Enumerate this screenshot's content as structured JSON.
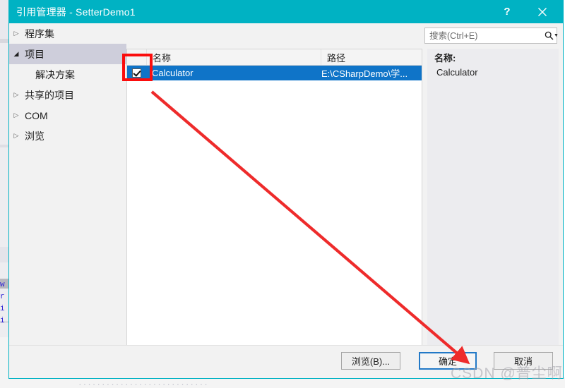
{
  "window": {
    "title": "引用管理器 - SetterDemo1",
    "help_label": "?",
    "close_label": "×",
    "accent_color": "#00b2c3"
  },
  "search": {
    "placeholder": "搜索(Ctrl+E)",
    "value": "",
    "icon": "search-icon",
    "dropdown_icon": "chevron-down-icon"
  },
  "tree": {
    "items": [
      {
        "label": "程序集",
        "arrow": "▷",
        "state": "collapsed",
        "level": 0,
        "selected": false
      },
      {
        "label": "项目",
        "arrow": "◢",
        "state": "expanded",
        "level": 0,
        "selected": true
      },
      {
        "label": "解决方案",
        "arrow": "",
        "state": "leaf",
        "level": 1,
        "selected": false
      },
      {
        "label": "共享的项目",
        "arrow": "▷",
        "state": "collapsed",
        "level": 0,
        "selected": false
      },
      {
        "label": "COM",
        "arrow": "▷",
        "state": "collapsed",
        "level": 0,
        "selected": false
      },
      {
        "label": "浏览",
        "arrow": "▷",
        "state": "collapsed",
        "level": 0,
        "selected": false
      }
    ]
  },
  "list": {
    "columns": [
      "",
      "名称",
      "路径"
    ],
    "rows": [
      {
        "checked": true,
        "name": "Calculator",
        "path": "E:\\CSharpDemo\\学...",
        "selected": true
      }
    ]
  },
  "detail": {
    "label": "名称:",
    "value": "Calculator"
  },
  "footer": {
    "browse_label": "浏览(B)...",
    "ok_label": "确定",
    "cancel_label": "取消"
  },
  "annotations": {
    "highlight_color": "#fb0d0d",
    "rect_target": "row-checkbox",
    "arrow_from": "row-checkbox",
    "arrow_to": "ok-button"
  },
  "watermark": {
    "text": "CSDN @普尘啊"
  },
  "background": {
    "code_column": "w\nr\ni\ni",
    "bottom_text": "............................"
  }
}
